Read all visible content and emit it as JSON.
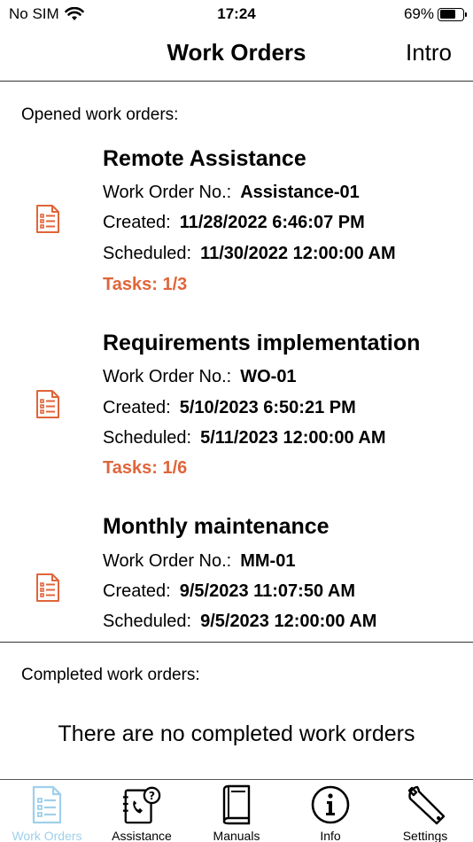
{
  "status_bar": {
    "carrier": "No SIM",
    "time": "17:24",
    "battery": "69%",
    "battery_level": 0.69
  },
  "nav": {
    "title": "Work Orders",
    "right_button": "Intro"
  },
  "opened_label": "Opened work orders:",
  "field_labels": {
    "number": "Work Order No.:",
    "created": "Created:",
    "scheduled": "Scheduled:"
  },
  "work_orders": [
    {
      "title": "Remote Assistance",
      "number": "Assistance-01",
      "created": "11/28/2022 6:46:07 PM",
      "scheduled": "11/30/2022 12:00:00 AM",
      "tasks": "Tasks: 1/3"
    },
    {
      "title": "Requirements implementation",
      "number": "WO-01",
      "created": "5/10/2023 6:50:21 PM",
      "scheduled": "5/11/2023 12:00:00 AM",
      "tasks": "Tasks: 1/6"
    },
    {
      "title": "Monthly maintenance",
      "number": "MM-01",
      "created": "9/5/2023 11:07:50 AM",
      "scheduled": "9/5/2023 12:00:00 AM"
    }
  ],
  "completed_label": "Completed work orders:",
  "completed_empty": "There are no completed work orders",
  "tabs": [
    {
      "label": "Work Orders",
      "icon": "document-icon",
      "active": true
    },
    {
      "label": "Assistance",
      "icon": "phone-book-icon",
      "active": false
    },
    {
      "label": "Manuals",
      "icon": "book-icon",
      "active": false
    },
    {
      "label": "Info",
      "icon": "info-icon",
      "active": false
    },
    {
      "label": "Settings",
      "icon": "wrench-icon",
      "active": false
    }
  ],
  "colors": {
    "accent": "#e0653a",
    "tab_active": "#9fd0ea",
    "text": "#000000"
  }
}
